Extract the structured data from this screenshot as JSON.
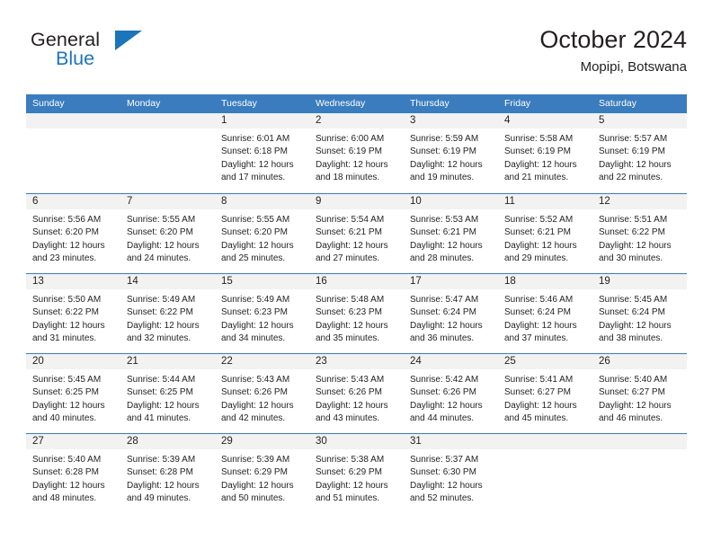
{
  "brand": {
    "name_top": "General",
    "name_bottom": "Blue",
    "accent_color": "#1b75bb",
    "flag_icon": "flag-triangle-icon"
  },
  "header": {
    "title": "October 2024",
    "subtitle": "Mopipi, Botswana"
  },
  "theme": {
    "header_row_bg": "#3a7cbe",
    "daynum_bg": "#f2f2f2",
    "grid_line": "#3a7cbe",
    "text": "#231f20"
  },
  "weekdays": [
    "Sunday",
    "Monday",
    "Tuesday",
    "Wednesday",
    "Thursday",
    "Friday",
    "Saturday"
  ],
  "weeks": [
    [
      {
        "day": "",
        "sunrise": "",
        "sunset": "",
        "daylight_1": "",
        "daylight_2": "",
        "empty": true
      },
      {
        "day": "",
        "sunrise": "",
        "sunset": "",
        "daylight_1": "",
        "daylight_2": "",
        "empty": true
      },
      {
        "day": "1",
        "sunrise": "Sunrise: 6:01 AM",
        "sunset": "Sunset: 6:18 PM",
        "daylight_1": "Daylight: 12 hours",
        "daylight_2": "and 17 minutes.",
        "empty": false
      },
      {
        "day": "2",
        "sunrise": "Sunrise: 6:00 AM",
        "sunset": "Sunset: 6:19 PM",
        "daylight_1": "Daylight: 12 hours",
        "daylight_2": "and 18 minutes.",
        "empty": false
      },
      {
        "day": "3",
        "sunrise": "Sunrise: 5:59 AM",
        "sunset": "Sunset: 6:19 PM",
        "daylight_1": "Daylight: 12 hours",
        "daylight_2": "and 19 minutes.",
        "empty": false
      },
      {
        "day": "4",
        "sunrise": "Sunrise: 5:58 AM",
        "sunset": "Sunset: 6:19 PM",
        "daylight_1": "Daylight: 12 hours",
        "daylight_2": "and 21 minutes.",
        "empty": false
      },
      {
        "day": "5",
        "sunrise": "Sunrise: 5:57 AM",
        "sunset": "Sunset: 6:19 PM",
        "daylight_1": "Daylight: 12 hours",
        "daylight_2": "and 22 minutes.",
        "empty": false
      }
    ],
    [
      {
        "day": "6",
        "sunrise": "Sunrise: 5:56 AM",
        "sunset": "Sunset: 6:20 PM",
        "daylight_1": "Daylight: 12 hours",
        "daylight_2": "and 23 minutes.",
        "empty": false
      },
      {
        "day": "7",
        "sunrise": "Sunrise: 5:55 AM",
        "sunset": "Sunset: 6:20 PM",
        "daylight_1": "Daylight: 12 hours",
        "daylight_2": "and 24 minutes.",
        "empty": false
      },
      {
        "day": "8",
        "sunrise": "Sunrise: 5:55 AM",
        "sunset": "Sunset: 6:20 PM",
        "daylight_1": "Daylight: 12 hours",
        "daylight_2": "and 25 minutes.",
        "empty": false
      },
      {
        "day": "9",
        "sunrise": "Sunrise: 5:54 AM",
        "sunset": "Sunset: 6:21 PM",
        "daylight_1": "Daylight: 12 hours",
        "daylight_2": "and 27 minutes.",
        "empty": false
      },
      {
        "day": "10",
        "sunrise": "Sunrise: 5:53 AM",
        "sunset": "Sunset: 6:21 PM",
        "daylight_1": "Daylight: 12 hours",
        "daylight_2": "and 28 minutes.",
        "empty": false
      },
      {
        "day": "11",
        "sunrise": "Sunrise: 5:52 AM",
        "sunset": "Sunset: 6:21 PM",
        "daylight_1": "Daylight: 12 hours",
        "daylight_2": "and 29 minutes.",
        "empty": false
      },
      {
        "day": "12",
        "sunrise": "Sunrise: 5:51 AM",
        "sunset": "Sunset: 6:22 PM",
        "daylight_1": "Daylight: 12 hours",
        "daylight_2": "and 30 minutes.",
        "empty": false
      }
    ],
    [
      {
        "day": "13",
        "sunrise": "Sunrise: 5:50 AM",
        "sunset": "Sunset: 6:22 PM",
        "daylight_1": "Daylight: 12 hours",
        "daylight_2": "and 31 minutes.",
        "empty": false
      },
      {
        "day": "14",
        "sunrise": "Sunrise: 5:49 AM",
        "sunset": "Sunset: 6:22 PM",
        "daylight_1": "Daylight: 12 hours",
        "daylight_2": "and 32 minutes.",
        "empty": false
      },
      {
        "day": "15",
        "sunrise": "Sunrise: 5:49 AM",
        "sunset": "Sunset: 6:23 PM",
        "daylight_1": "Daylight: 12 hours",
        "daylight_2": "and 34 minutes.",
        "empty": false
      },
      {
        "day": "16",
        "sunrise": "Sunrise: 5:48 AM",
        "sunset": "Sunset: 6:23 PM",
        "daylight_1": "Daylight: 12 hours",
        "daylight_2": "and 35 minutes.",
        "empty": false
      },
      {
        "day": "17",
        "sunrise": "Sunrise: 5:47 AM",
        "sunset": "Sunset: 6:24 PM",
        "daylight_1": "Daylight: 12 hours",
        "daylight_2": "and 36 minutes.",
        "empty": false
      },
      {
        "day": "18",
        "sunrise": "Sunrise: 5:46 AM",
        "sunset": "Sunset: 6:24 PM",
        "daylight_1": "Daylight: 12 hours",
        "daylight_2": "and 37 minutes.",
        "empty": false
      },
      {
        "day": "19",
        "sunrise": "Sunrise: 5:45 AM",
        "sunset": "Sunset: 6:24 PM",
        "daylight_1": "Daylight: 12 hours",
        "daylight_2": "and 38 minutes.",
        "empty": false
      }
    ],
    [
      {
        "day": "20",
        "sunrise": "Sunrise: 5:45 AM",
        "sunset": "Sunset: 6:25 PM",
        "daylight_1": "Daylight: 12 hours",
        "daylight_2": "and 40 minutes.",
        "empty": false
      },
      {
        "day": "21",
        "sunrise": "Sunrise: 5:44 AM",
        "sunset": "Sunset: 6:25 PM",
        "daylight_1": "Daylight: 12 hours",
        "daylight_2": "and 41 minutes.",
        "empty": false
      },
      {
        "day": "22",
        "sunrise": "Sunrise: 5:43 AM",
        "sunset": "Sunset: 6:26 PM",
        "daylight_1": "Daylight: 12 hours",
        "daylight_2": "and 42 minutes.",
        "empty": false
      },
      {
        "day": "23",
        "sunrise": "Sunrise: 5:43 AM",
        "sunset": "Sunset: 6:26 PM",
        "daylight_1": "Daylight: 12 hours",
        "daylight_2": "and 43 minutes.",
        "empty": false
      },
      {
        "day": "24",
        "sunrise": "Sunrise: 5:42 AM",
        "sunset": "Sunset: 6:26 PM",
        "daylight_1": "Daylight: 12 hours",
        "daylight_2": "and 44 minutes.",
        "empty": false
      },
      {
        "day": "25",
        "sunrise": "Sunrise: 5:41 AM",
        "sunset": "Sunset: 6:27 PM",
        "daylight_1": "Daylight: 12 hours",
        "daylight_2": "and 45 minutes.",
        "empty": false
      },
      {
        "day": "26",
        "sunrise": "Sunrise: 5:40 AM",
        "sunset": "Sunset: 6:27 PM",
        "daylight_1": "Daylight: 12 hours",
        "daylight_2": "and 46 minutes.",
        "empty": false
      }
    ],
    [
      {
        "day": "27",
        "sunrise": "Sunrise: 5:40 AM",
        "sunset": "Sunset: 6:28 PM",
        "daylight_1": "Daylight: 12 hours",
        "daylight_2": "and 48 minutes.",
        "empty": false
      },
      {
        "day": "28",
        "sunrise": "Sunrise: 5:39 AM",
        "sunset": "Sunset: 6:28 PM",
        "daylight_1": "Daylight: 12 hours",
        "daylight_2": "and 49 minutes.",
        "empty": false
      },
      {
        "day": "29",
        "sunrise": "Sunrise: 5:39 AM",
        "sunset": "Sunset: 6:29 PM",
        "daylight_1": "Daylight: 12 hours",
        "daylight_2": "and 50 minutes.",
        "empty": false
      },
      {
        "day": "30",
        "sunrise": "Sunrise: 5:38 AM",
        "sunset": "Sunset: 6:29 PM",
        "daylight_1": "Daylight: 12 hours",
        "daylight_2": "and 51 minutes.",
        "empty": false
      },
      {
        "day": "31",
        "sunrise": "Sunrise: 5:37 AM",
        "sunset": "Sunset: 6:30 PM",
        "daylight_1": "Daylight: 12 hours",
        "daylight_2": "and 52 minutes.",
        "empty": false
      },
      {
        "day": "",
        "sunrise": "",
        "sunset": "",
        "daylight_1": "",
        "daylight_2": "",
        "empty": true
      },
      {
        "day": "",
        "sunrise": "",
        "sunset": "",
        "daylight_1": "",
        "daylight_2": "",
        "empty": true
      }
    ]
  ]
}
